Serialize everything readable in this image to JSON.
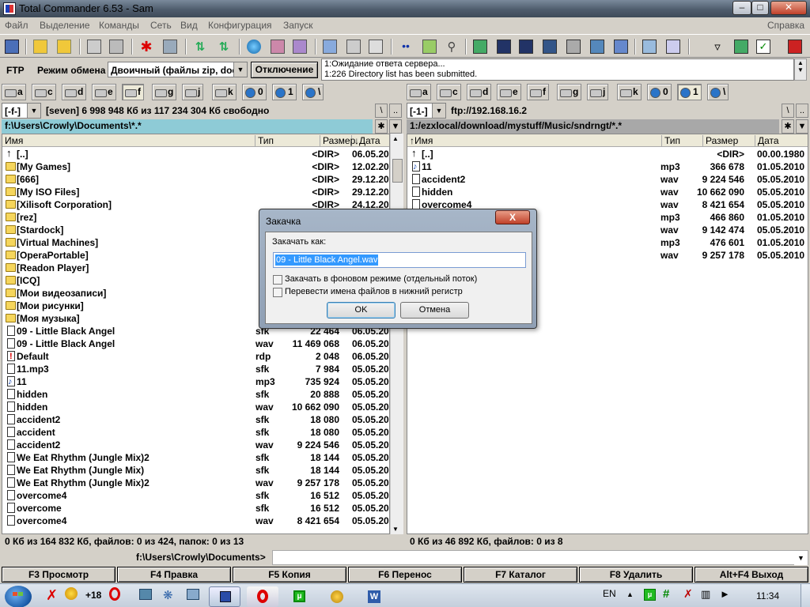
{
  "window": {
    "title": "Total Commander 6.53 - Sam"
  },
  "menu": [
    "Файл",
    "Выделение",
    "Команды",
    "Сеть",
    "Вид",
    "Конфигурация",
    "Запуск"
  ],
  "menu_help": "Справка",
  "ftp": {
    "label": "FTP",
    "mode_label": "Режим обмена",
    "mode_value": "Двоичный (файлы zip, doc",
    "disconnect": "Отключение",
    "log": [
      "1:Ожидание ответа сервера...",
      "1:226 Directory list has been submitted."
    ]
  },
  "drives_left": [
    "a",
    "c",
    "d",
    "e",
    "f",
    "g",
    "j",
    "k",
    "0",
    "1",
    "\\"
  ],
  "drives_right": [
    "a",
    "c",
    "d",
    "e",
    "f",
    "g",
    "j",
    "k",
    "0",
    "1",
    "\\"
  ],
  "left": {
    "drive_combo": "[-f-]",
    "info": "[seven]  6 998 948 Кб из 117 234 304 Кб свободно",
    "path": "f:\\Users\\Crowly\\Documents\\*.*",
    "columns": {
      "name": "Имя",
      "type": "Тип",
      "size": "Размер",
      "date": "↓Дата"
    },
    "files": [
      {
        "icon": "up",
        "name": "[..]",
        "type": "",
        "size": "<DIR>",
        "date": "06.05.20"
      },
      {
        "icon": "folder",
        "name": "[My Games]",
        "type": "",
        "size": "<DIR>",
        "date": "12.02.20"
      },
      {
        "icon": "folder",
        "name": "[666]",
        "type": "",
        "size": "<DIR>",
        "date": "29.12.20"
      },
      {
        "icon": "folder",
        "name": "[My ISO Files]",
        "type": "",
        "size": "<DIR>",
        "date": "29.12.20"
      },
      {
        "icon": "folder",
        "name": "[Xilisoft Corporation]",
        "type": "",
        "size": "<DIR>",
        "date": "24.12.20"
      },
      {
        "icon": "folder",
        "name": "[rez]",
        "type": "",
        "size": "",
        "date": ""
      },
      {
        "icon": "folder",
        "name": "[Stardock]",
        "type": "",
        "size": "",
        "date": ""
      },
      {
        "icon": "folder",
        "name": "[Virtual Machines]",
        "type": "",
        "size": "",
        "date": ""
      },
      {
        "icon": "folder",
        "name": "[OperaPortable]",
        "type": "",
        "size": "",
        "date": ""
      },
      {
        "icon": "folder",
        "name": "[Readon Player]",
        "type": "",
        "size": "",
        "date": ""
      },
      {
        "icon": "folder",
        "name": "[ICQ]",
        "type": "",
        "size": "",
        "date": ""
      },
      {
        "icon": "folder",
        "name": "[Мои видеозаписи]",
        "type": "",
        "size": "",
        "date": ""
      },
      {
        "icon": "folder",
        "name": "[Мои рисунки]",
        "type": "",
        "size": "",
        "date": ""
      },
      {
        "icon": "folder",
        "name": "[Моя музыка]",
        "type": "",
        "size": "",
        "date": ""
      },
      {
        "icon": "file",
        "name": "09 - Little Black Angel",
        "type": "sfk",
        "size": "22 464",
        "date": "06.05.20"
      },
      {
        "icon": "file",
        "name": "09 - Little Black Angel",
        "type": "wav",
        "size": "11 469 068",
        "date": "06.05.20"
      },
      {
        "icon": "rdp",
        "name": "Default",
        "type": "rdp",
        "size": "2 048",
        "date": "06.05.20"
      },
      {
        "icon": "file",
        "name": "11.mp3",
        "type": "sfk",
        "size": "7 984",
        "date": "05.05.20"
      },
      {
        "icon": "music",
        "name": "11",
        "type": "mp3",
        "size": "735 924",
        "date": "05.05.20"
      },
      {
        "icon": "file",
        "name": "hidden",
        "type": "sfk",
        "size": "20 888",
        "date": "05.05.20"
      },
      {
        "icon": "file",
        "name": "hidden",
        "type": "wav",
        "size": "10 662 090",
        "date": "05.05.20"
      },
      {
        "icon": "file",
        "name": "accident2",
        "type": "sfk",
        "size": "18 080",
        "date": "05.05.20"
      },
      {
        "icon": "file",
        "name": "accident",
        "type": "sfk",
        "size": "18 080",
        "date": "05.05.20"
      },
      {
        "icon": "file",
        "name": "accident2",
        "type": "wav",
        "size": "9 224 546",
        "date": "05.05.20"
      },
      {
        "icon": "file",
        "name": "We Eat Rhythm (Jungle Mix)2",
        "type": "sfk",
        "size": "18 144",
        "date": "05.05.20"
      },
      {
        "icon": "file",
        "name": "We Eat Rhythm (Jungle Mix)",
        "type": "sfk",
        "size": "18 144",
        "date": "05.05.20"
      },
      {
        "icon": "file",
        "name": "We Eat Rhythm (Jungle Mix)2",
        "type": "wav",
        "size": "9 257 178",
        "date": "05.05.20"
      },
      {
        "icon": "file",
        "name": "overcome4",
        "type": "sfk",
        "size": "16 512",
        "date": "05.05.20"
      },
      {
        "icon": "file",
        "name": "overcome",
        "type": "sfk",
        "size": "16 512",
        "date": "05.05.20"
      },
      {
        "icon": "file",
        "name": "overcome4",
        "type": "wav",
        "size": "8 421 654",
        "date": "05.05.20"
      }
    ],
    "status": "0 Кб из 164 832 Кб, файлов: 0 из 424, папок: 0 из 13"
  },
  "right": {
    "drive_combo": "[-1-]",
    "info": "ftp://192.168.16.2",
    "path": "1:/ezxlocal/download/mystuff/Music/sndrngt/*.*",
    "columns": {
      "name": "↑Имя",
      "type": "Тип",
      "size": "Размер",
      "date": "Дата"
    },
    "files": [
      {
        "icon": "up",
        "name": "[..]",
        "type": "",
        "size": "<DIR>",
        "date": "00.00.1980"
      },
      {
        "icon": "music",
        "name": "11",
        "type": "mp3",
        "size": "366 678",
        "date": "01.05.2010"
      },
      {
        "icon": "file",
        "name": "accident2",
        "type": "wav",
        "size": "9 224 546",
        "date": "05.05.2010"
      },
      {
        "icon": "file",
        "name": "hidden",
        "type": "wav",
        "size": "10 662 090",
        "date": "05.05.2010"
      },
      {
        "icon": "file",
        "name": "overcome4",
        "type": "wav",
        "size": "8 421 654",
        "date": "05.05.2010"
      },
      {
        "icon": "none",
        "name": "",
        "type": "mp3",
        "size": "466 860",
        "date": "01.05.2010"
      },
      {
        "icon": "none",
        "name": "",
        "type": "wav",
        "size": "9 142 474",
        "date": "05.05.2010"
      },
      {
        "icon": "none",
        "name": "",
        "type": "mp3",
        "size": "476 601",
        "date": "01.05.2010"
      },
      {
        "icon": "none",
        "name": "x)2",
        "type": "wav",
        "size": "9 257 178",
        "date": "05.05.2010"
      }
    ],
    "status": "0 Кб из 46 892 Кб, файлов: 0 из 8"
  },
  "cmdline": {
    "path": "f:\\Users\\Crowly\\Documents>"
  },
  "fkeys": [
    "F3 Просмотр",
    "F4 Правка",
    "F5 Копия",
    "F6 Перенос",
    "F7 Каталог",
    "F8 Удалить",
    "Alt+F4 Выход"
  ],
  "dialog": {
    "title": "Закачка",
    "close": "X",
    "label": "Закачать как:",
    "filename": "09 - Little Black Angel.wav",
    "check1": "Закачать в фоновом режиме (отдельный поток)",
    "check2": "Перевести имена файлов в нижний регистр",
    "ok": "OK",
    "cancel": "Отмена"
  },
  "taskbar": {
    "badge": "+18",
    "lang": "EN",
    "clock": "11:34"
  },
  "colors": {
    "path_active": "#8ecbd6",
    "path_inactive": "#a8a8a8",
    "dialog_accent": "#3399ff"
  }
}
